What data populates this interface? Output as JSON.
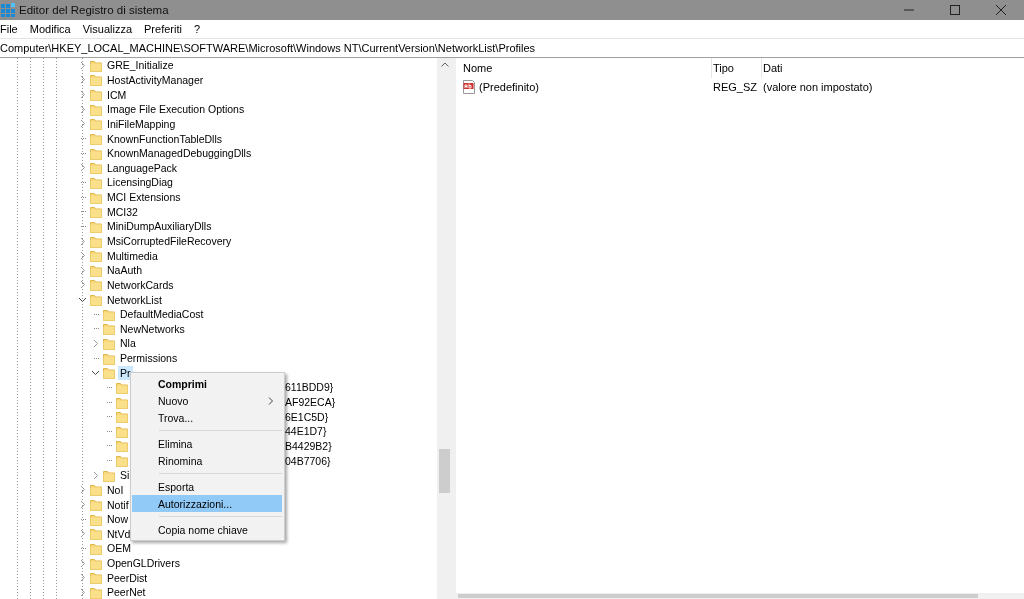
{
  "window": {
    "title": "Editor del Registro di sistema"
  },
  "menu_bar": [
    "File",
    "Modifica",
    "Visualizza",
    "Preferiti",
    "?"
  ],
  "address": "Computer\\HKEY_LOCAL_MACHINE\\SOFTWARE\\Microsoft\\Windows NT\\CurrentVersion\\NetworkList\\Profiles",
  "tree": [
    {
      "label": "GRE_Initialize",
      "expandable": true,
      "expanded": false,
      "selected": false
    },
    {
      "label": "HostActivityManager",
      "expandable": true,
      "expanded": false,
      "selected": false
    },
    {
      "label": "ICM",
      "expandable": true,
      "expanded": false,
      "selected": false
    },
    {
      "label": "Image File Execution Options",
      "expandable": true,
      "expanded": false,
      "selected": false
    },
    {
      "label": "IniFileMapping",
      "expandable": true,
      "expanded": false,
      "selected": false
    },
    {
      "label": "KnownFunctionTableDlls",
      "expandable": false,
      "selected": false
    },
    {
      "label": "KnownManagedDebuggingDlls",
      "expandable": false,
      "selected": false
    },
    {
      "label": "LanguagePack",
      "expandable": true,
      "expanded": false,
      "selected": false
    },
    {
      "label": "LicensingDiag",
      "expandable": false,
      "selected": false
    },
    {
      "label": "MCI Extensions",
      "expandable": false,
      "selected": false
    },
    {
      "label": "MCI32",
      "expandable": false,
      "selected": false
    },
    {
      "label": "MiniDumpAuxiliaryDlls",
      "expandable": false,
      "selected": false
    },
    {
      "label": "MsiCorruptedFileRecovery",
      "expandable": true,
      "expanded": false,
      "selected": false
    },
    {
      "label": "Multimedia",
      "expandable": true,
      "expanded": false,
      "selected": false
    },
    {
      "label": "NaAuth",
      "expandable": true,
      "expanded": false,
      "selected": false
    },
    {
      "label": "NetworkCards",
      "expandable": true,
      "expanded": false,
      "selected": false
    },
    {
      "label": "NetworkList",
      "expandable": true,
      "expanded": true,
      "selected": false,
      "children": [
        {
          "label": "DefaultMediaCost",
          "expandable": false,
          "selected": false
        },
        {
          "label": "NewNetworks",
          "expandable": false,
          "selected": false
        },
        {
          "label": "Nla",
          "expandable": true,
          "expanded": false,
          "selected": false
        },
        {
          "label": "Permissions",
          "expandable": false,
          "selected": false
        },
        {
          "label": "Pr",
          "expandable": true,
          "expanded": true,
          "selected": true,
          "children": [
            {
              "label": "611BDD9}",
              "kind": "covered",
              "expandable": false,
              "selected": false
            },
            {
              "label": "AF92ECA}",
              "kind": "covered",
              "expandable": false,
              "selected": false
            },
            {
              "label": "6E1C5D}",
              "kind": "covered",
              "expandable": false,
              "selected": false
            },
            {
              "label": "44E1D7}",
              "kind": "covered",
              "expandable": false,
              "selected": false
            },
            {
              "label": "B4429B2}",
              "kind": "covered",
              "expandable": false,
              "selected": false
            },
            {
              "label": "04B7706}",
              "kind": "covered",
              "expandable": false,
              "selected": false
            }
          ]
        },
        {
          "label": "Si",
          "expandable": true,
          "expanded": false,
          "selected": false
        }
      ]
    },
    {
      "label": "NoI",
      "expandable": true,
      "expanded": false,
      "selected": false
    },
    {
      "label": "Notif",
      "expandable": true,
      "expanded": false,
      "selected": false
    },
    {
      "label": "Now",
      "expandable": false,
      "selected": false
    },
    {
      "label": "NtVd",
      "expandable": true,
      "expanded": false,
      "selected": false
    },
    {
      "label": "OEM",
      "expandable": false,
      "selected": false
    },
    {
      "label": "OpenGLDrivers",
      "expandable": true,
      "expanded": false,
      "selected": false
    },
    {
      "label": "PeerDist",
      "expandable": true,
      "expanded": false,
      "selected": false
    },
    {
      "label": "PeerNet",
      "expandable": true,
      "expanded": false,
      "selected": false
    }
  ],
  "values": {
    "columns": [
      "Nome",
      "Tipo",
      "Dati"
    ],
    "rows": [
      {
        "name": "(Predefinito)",
        "type": "REG_SZ",
        "data": "(valore non impostato)"
      }
    ]
  },
  "context_menu": [
    {
      "kind": "item",
      "label": "Comprimi",
      "default": true,
      "submenu": false,
      "selected": false
    },
    {
      "kind": "item",
      "label": "Nuovo",
      "default": false,
      "submenu": true,
      "selected": false
    },
    {
      "kind": "item",
      "label": "Trova...",
      "default": false,
      "submenu": false,
      "selected": false
    },
    {
      "kind": "separator"
    },
    {
      "kind": "item",
      "label": "Elimina",
      "default": false,
      "submenu": false,
      "selected": false
    },
    {
      "kind": "item",
      "label": "Rinomina",
      "default": false,
      "submenu": false,
      "selected": false
    },
    {
      "kind": "separator"
    },
    {
      "kind": "item",
      "label": "Esporta",
      "default": false,
      "submenu": false,
      "selected": false
    },
    {
      "kind": "item",
      "label": "Autorizzazioni...",
      "default": false,
      "submenu": false,
      "selected": true
    },
    {
      "kind": "separator"
    },
    {
      "kind": "item",
      "label": "Copia nome chiave",
      "default": false,
      "submenu": false,
      "selected": false
    }
  ]
}
